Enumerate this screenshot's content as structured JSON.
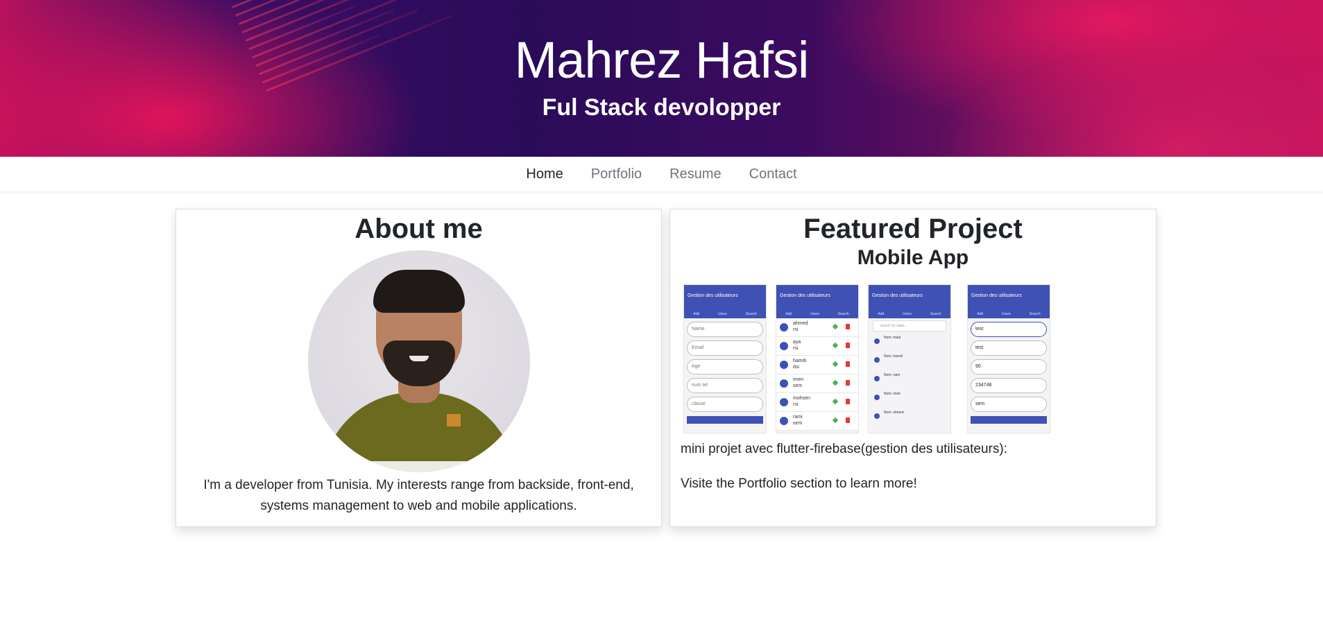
{
  "header": {
    "name": "Mahrez Hafsi",
    "subtitle": "Ful Stack devolopper"
  },
  "nav": {
    "items": [
      "Home",
      "Portfolio",
      "Resume",
      "Contact"
    ],
    "active": "Home"
  },
  "about": {
    "title": "About me",
    "text": "I'm a developer from Tunisia. My interests range from backside, front-end, systems management to web and mobile applications."
  },
  "project": {
    "title": "Featured Project",
    "subtitle": "Mobile App",
    "description": "mini projet avec flutter-firebase(gestion des utilisateurs):",
    "cta_text": "Visite the Portfolio section to learn more!",
    "screens": {
      "app_title": "Gestion des utilisateurs",
      "tabs": [
        "Add",
        "Users",
        "Search"
      ],
      "add_fields": [
        "Name",
        "Email",
        "Age",
        "num tel",
        "classe"
      ],
      "users": [
        {
          "name": "ahmed",
          "class": "rsi"
        },
        {
          "name": "aya",
          "class": "rsi"
        },
        {
          "name": "hamdi",
          "class": "dsi"
        },
        {
          "name": "imen",
          "class": "sem"
        },
        {
          "name": "mohsen",
          "class": "rsi"
        },
        {
          "name": "rami",
          "class": "sem"
        }
      ],
      "search_placeholder": "search by class...",
      "search_results": [
        "Nom: maal",
        "Nom: hamdi",
        "Nom: rami",
        "Nom: imen",
        "Nom: ahmed"
      ],
      "edit_values": [
        "test",
        "test",
        "90",
        "234748",
        "sem"
      ]
    }
  },
  "colors": {
    "app_primary": "#3f51b5",
    "nav_inactive": "#6c757d",
    "text": "#212529"
  }
}
